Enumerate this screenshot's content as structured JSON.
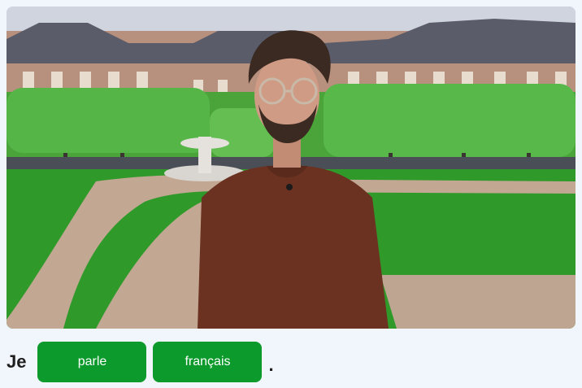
{
  "video": {
    "scene": "man-in-park"
  },
  "sentence": {
    "words": [
      "Je"
    ],
    "chips": [
      "parle",
      "français"
    ],
    "punctuation": "."
  },
  "colors": {
    "background": "#f1f5fc",
    "chip": "#0b9a2b",
    "chip_text": "#ffffff",
    "text": "#1e1e1e"
  }
}
